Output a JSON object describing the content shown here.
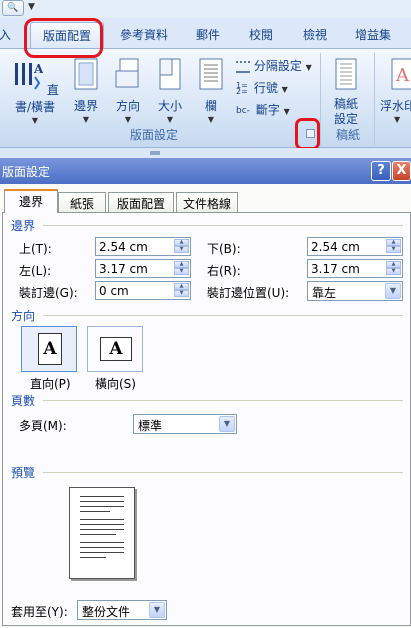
{
  "ribbon": {
    "qat_arrow": "▼",
    "tabs": [
      "入",
      "版面配置",
      "參考資料",
      "郵件",
      "校閱",
      "檢視",
      "增益集"
    ],
    "buttons": {
      "text_direction": "直書/橫書",
      "margins": "邊界",
      "orientation": "方向",
      "size": "大小",
      "columns": "欄",
      "breaks": "分隔設定",
      "line_numbers": "行號",
      "hyphenation": "斷字",
      "manuscript": "稿紙設定",
      "watermark": "浮水印"
    },
    "groups": {
      "page_setup": "版面設定",
      "manuscript": "稿紙"
    }
  },
  "dialog": {
    "title": "版面設定",
    "help": "?",
    "close": "X",
    "tabs": [
      "邊界",
      "紙張",
      "版面配置",
      "文件格線"
    ],
    "margins_section": "邊界",
    "top_label": "上(T):",
    "top_value": "2.54 cm",
    "bottom_label": "下(B):",
    "bottom_value": "2.54 cm",
    "left_label": "左(L):",
    "left_value": "3.17 cm",
    "right_label": "右(R):",
    "right_value": "3.17 cm",
    "gutter_label": "裝訂邊(G):",
    "gutter_value": "0 cm",
    "gutter_pos_label": "裝訂邊位置(U):",
    "gutter_pos_value": "靠左",
    "orientation_section": "方向",
    "portrait": "直向(P)",
    "landscape": "橫向(S)",
    "orientation_glyph": "A",
    "pages_section": "頁數",
    "multiple_pages_label": "多頁(M):",
    "multiple_pages_value": "標準",
    "preview_section": "預覽",
    "apply_to_label": "套用至(Y):",
    "apply_to_value": "整份文件"
  },
  "colors": {
    "accent_ring": "#e4151f",
    "section_title": "#1f4fb0",
    "titlebar": "#4b6fc6"
  }
}
